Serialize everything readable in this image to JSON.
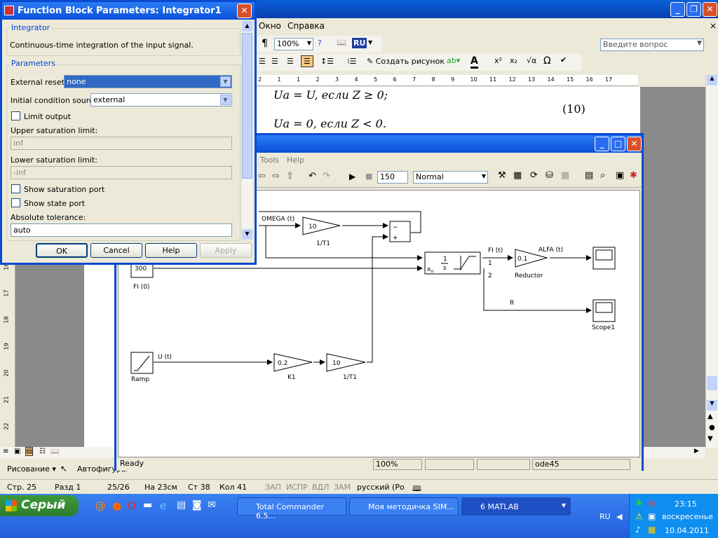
{
  "word": {
    "menu": [
      "Окно",
      "Справка"
    ],
    "help_placeholder": "Введите вопрос",
    "zoom": "100%",
    "lang_button": "RU",
    "create_picture": "Создать рисунок",
    "ruler_ticks": [
      "2",
      "1",
      "1",
      "2",
      "3",
      "4",
      "5",
      "6",
      "7",
      "8",
      "9",
      "10",
      "11",
      "12",
      "13",
      "14",
      "15",
      "16",
      "17"
    ],
    "vruler_ticks": [
      "16",
      "17",
      "18",
      "19",
      "20",
      "21",
      "22"
    ],
    "formula_line1": "Ua = U, если Z ≥ 0;",
    "formula_number": "(10)",
    "formula_line2": "Ua = 0, если Z < 0.",
    "draw_label": "Рисование ▾",
    "autoshapes_label": "Автофигуры",
    "status": {
      "page": "Стр. 25",
      "section": "Разд 1",
      "pages": "25/26",
      "at": "На 23см",
      "line": "Ст 38",
      "col": "Кол 41",
      "rec": "ЗАП",
      "trk": "ИСПР",
      "ext": "ВДЛ",
      "ovr": "ЗАМ",
      "lang": "русский (Ро"
    }
  },
  "simulink": {
    "menu": [
      "Tools",
      "Help"
    ],
    "stop_time": "150",
    "sim_mode": "Normal",
    "status_ready": "Ready",
    "status_zoom": "100%",
    "status_solver": "ode45",
    "blocks": {
      "omega_signal": "OMEGA (t)",
      "gain1_value": "10",
      "gain1_name": "1/T1",
      "sum_minus": "−",
      "sum_plus": "+",
      "const_value": "300",
      "const_name": "FI (0)",
      "integrator_num": "1",
      "integrator_den": "s",
      "integrator_x0": "x",
      "integrator_x0_sub": "o",
      "integrator_port1": "1",
      "integrator_port2": "2",
      "fi_signal": "FI (t)",
      "reductor_value": "0.1",
      "reductor_name": "Reductor",
      "alfa_signal": "ALFA (t)",
      "r_signal": "R",
      "scope1_name": "Scope1",
      "ramp_name": "Ramp",
      "u_signal": "U (t)",
      "k1_value": "0.2",
      "k1_name": "K1",
      "gain2_value": "10",
      "gain2_name": "1/T1"
    }
  },
  "dialog": {
    "title": "Function Block Parameters: Integrator1",
    "group1_label": "Integrator",
    "description": "Continuous-time integration of the input signal.",
    "group2_label": "Parameters",
    "external_reset_label": "External reset:",
    "external_reset_value": "none",
    "ic_source_label": "Initial condition source:",
    "ic_source_value": "external",
    "limit_output_label": "Limit output",
    "upper_label": "Upper saturation limit:",
    "upper_value": "inf",
    "lower_label": "Lower saturation limit:",
    "lower_value": "-inf",
    "show_sat_label": "Show saturation port",
    "show_state_label": "Show state port",
    "abs_tol_label": "Absolute tolerance:",
    "abs_tol_value": "auto",
    "ok": "OK",
    "cancel": "Cancel",
    "help": "Help",
    "apply": "Apply"
  },
  "taskbar": {
    "start": "Серый",
    "tasks": [
      "Total Commander 6.5...",
      "Моя методичка SIM...",
      "6 MATLAB"
    ],
    "lang": "RU",
    "time": "23:15",
    "day": "воскресенье",
    "date": "10.04.2011"
  }
}
